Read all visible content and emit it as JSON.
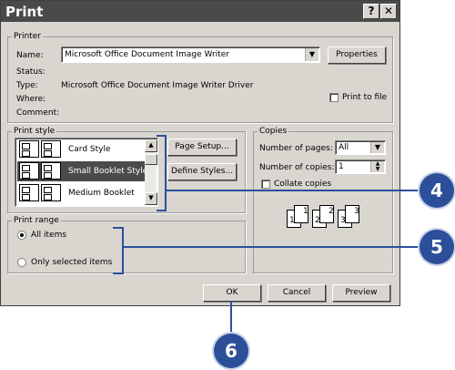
{
  "window": {
    "title": "Print",
    "help_glyph": "?",
    "close_glyph": "✕"
  },
  "printer": {
    "group_label": "Printer",
    "name_label": "Name:",
    "name_value": "Microsoft Office Document Image Writer",
    "properties_label": "Properties",
    "status_label": "Status:",
    "type_label": "Type:",
    "type_value": "Microsoft Office Document Image Writer Driver",
    "where_label": "Where:",
    "comment_label": "Comment:",
    "print_to_file_label": "Print to file"
  },
  "print_style": {
    "group_label": "Print style",
    "items": [
      {
        "label": "Card Style"
      },
      {
        "label": "Small Booklet Style",
        "selected": true
      },
      {
        "label": "Medium Booklet"
      }
    ],
    "page_setup_label": "Page Setup...",
    "define_styles_label": "Define Styles..."
  },
  "copies": {
    "group_label": "Copies",
    "pages_label": "Number of pages:",
    "pages_value": "All",
    "copies_label": "Number of copies:",
    "copies_value": "1",
    "collate_label": "Collate copies",
    "collate_pages": [
      "1",
      "1",
      "2",
      "2",
      "3",
      "3"
    ]
  },
  "print_range": {
    "group_label": "Print range",
    "all_items_label": "All items",
    "selected_items_label": "Only selected items"
  },
  "buttons": {
    "ok": "OK",
    "cancel": "Cancel",
    "preview": "Preview"
  },
  "callouts": {
    "style_step": "4",
    "range_step": "5",
    "ok_step": "6"
  },
  "colors": {
    "callout": "#2d4f9a",
    "dialog_face": "#d9d6d0",
    "title_bar": "#4a4a4a"
  }
}
